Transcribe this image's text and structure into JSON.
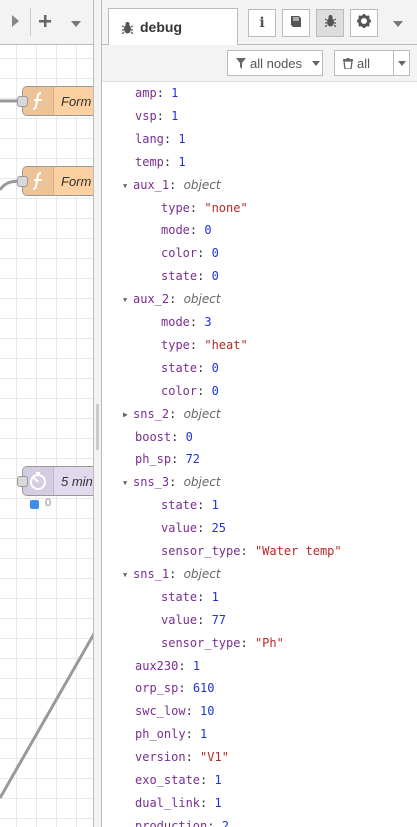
{
  "canvas": {
    "toolbar": {
      "deploy_icon": "triangle-right-icon",
      "add_icon": "plus-icon",
      "menu_icon": "chevron-down-icon"
    },
    "nodes": [
      {
        "type": "function",
        "label": "Form"
      },
      {
        "type": "function",
        "label": "Form"
      },
      {
        "type": "inject",
        "label": "5 min"
      }
    ],
    "status": {
      "text": "0",
      "color": "#3e8fe6"
    }
  },
  "sidebar": {
    "tab_label": "debug",
    "tab_icon": "bug-icon",
    "buttons": [
      "info-icon",
      "book-icon",
      "bug-icon",
      "gear-icon",
      "chevron-down-icon"
    ],
    "filter_nodes": "all nodes",
    "filter_clear": "all"
  },
  "debug_rows": [
    {
      "key": "amp",
      "value": "1",
      "kind": "num",
      "level": 0
    },
    {
      "key": "vsp",
      "value": "1",
      "kind": "num",
      "level": 0
    },
    {
      "key": "lang",
      "value": "1",
      "kind": "num",
      "level": 0
    },
    {
      "key": "temp",
      "value": "1",
      "kind": "num",
      "level": 0
    },
    {
      "key": "aux_1",
      "value": "object",
      "kind": "obj",
      "level": 0,
      "caret": "open"
    },
    {
      "key": "type",
      "value": "\"none\"",
      "kind": "str",
      "level": 1
    },
    {
      "key": "mode",
      "value": "0",
      "kind": "num",
      "level": 1
    },
    {
      "key": "color",
      "value": "0",
      "kind": "num",
      "level": 1
    },
    {
      "key": "state",
      "value": "0",
      "kind": "num",
      "level": 1
    },
    {
      "key": "aux_2",
      "value": "object",
      "kind": "obj",
      "level": 0,
      "caret": "open"
    },
    {
      "key": "mode",
      "value": "3",
      "kind": "num",
      "level": 1
    },
    {
      "key": "type",
      "value": "\"heat\"",
      "kind": "str",
      "level": 1
    },
    {
      "key": "state",
      "value": "0",
      "kind": "num",
      "level": 1
    },
    {
      "key": "color",
      "value": "0",
      "kind": "num",
      "level": 1
    },
    {
      "key": "sns_2",
      "value": "object",
      "kind": "obj",
      "level": 0,
      "caret": "closed"
    },
    {
      "key": "boost",
      "value": "0",
      "kind": "num",
      "level": 0
    },
    {
      "key": "ph_sp",
      "value": "72",
      "kind": "num",
      "level": 0
    },
    {
      "key": "sns_3",
      "value": "object",
      "kind": "obj",
      "level": 0,
      "caret": "open"
    },
    {
      "key": "state",
      "value": "1",
      "kind": "num",
      "level": 1
    },
    {
      "key": "value",
      "value": "25",
      "kind": "num",
      "level": 1
    },
    {
      "key": "sensor_type",
      "value": "\"Water temp\"",
      "kind": "str",
      "level": 1
    },
    {
      "key": "sns_1",
      "value": "object",
      "kind": "obj",
      "level": 0,
      "caret": "open"
    },
    {
      "key": "state",
      "value": "1",
      "kind": "num",
      "level": 1
    },
    {
      "key": "value",
      "value": "77",
      "kind": "num",
      "level": 1
    },
    {
      "key": "sensor_type",
      "value": "\"Ph\"",
      "kind": "str",
      "level": 1
    },
    {
      "key": "aux230",
      "value": "1",
      "kind": "num",
      "level": 0
    },
    {
      "key": "orp_sp",
      "value": "610",
      "kind": "num",
      "level": 0
    },
    {
      "key": "swc_low",
      "value": "10",
      "kind": "num",
      "level": 0
    },
    {
      "key": "ph_only",
      "value": "1",
      "kind": "num",
      "level": 0
    },
    {
      "key": "version",
      "value": "\"V1\"",
      "kind": "str",
      "level": 0
    },
    {
      "key": "exo_state",
      "value": "1",
      "kind": "num",
      "level": 0
    },
    {
      "key": "dual_link",
      "value": "1",
      "kind": "num",
      "level": 0
    },
    {
      "key": "production",
      "value": "2",
      "kind": "num",
      "level": 0
    }
  ]
}
